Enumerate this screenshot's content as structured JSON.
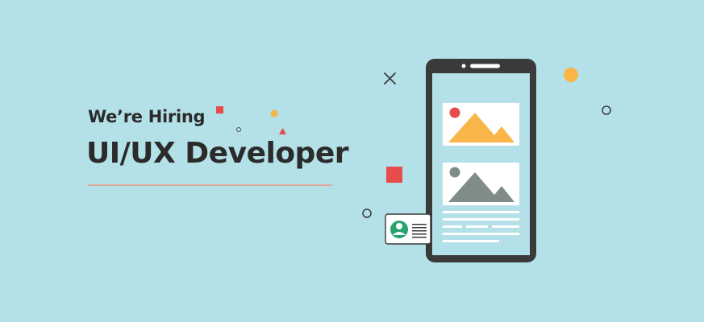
{
  "banner": {
    "subtitle": "We’re Hiring",
    "title": "UI/UX Developer"
  },
  "colors": {
    "background": "#b4e1e8",
    "text": "#2b2b2b",
    "rule": "#e3a89c",
    "phone_frame": "#3a3a3a",
    "phone_screen": "#b4e1e8",
    "card": "#ffffff",
    "mountain_orange": "#f9b548",
    "mountain_gray": "#7f8c8a",
    "accent_red": "#e74c4c",
    "accent_orange": "#f9b548",
    "id_card_green": "#27a36e"
  },
  "icons": {
    "close": "close-icon",
    "image_1": "image-placeholder-icon",
    "image_2": "image-placeholder-icon",
    "profile": "user-icon"
  }
}
